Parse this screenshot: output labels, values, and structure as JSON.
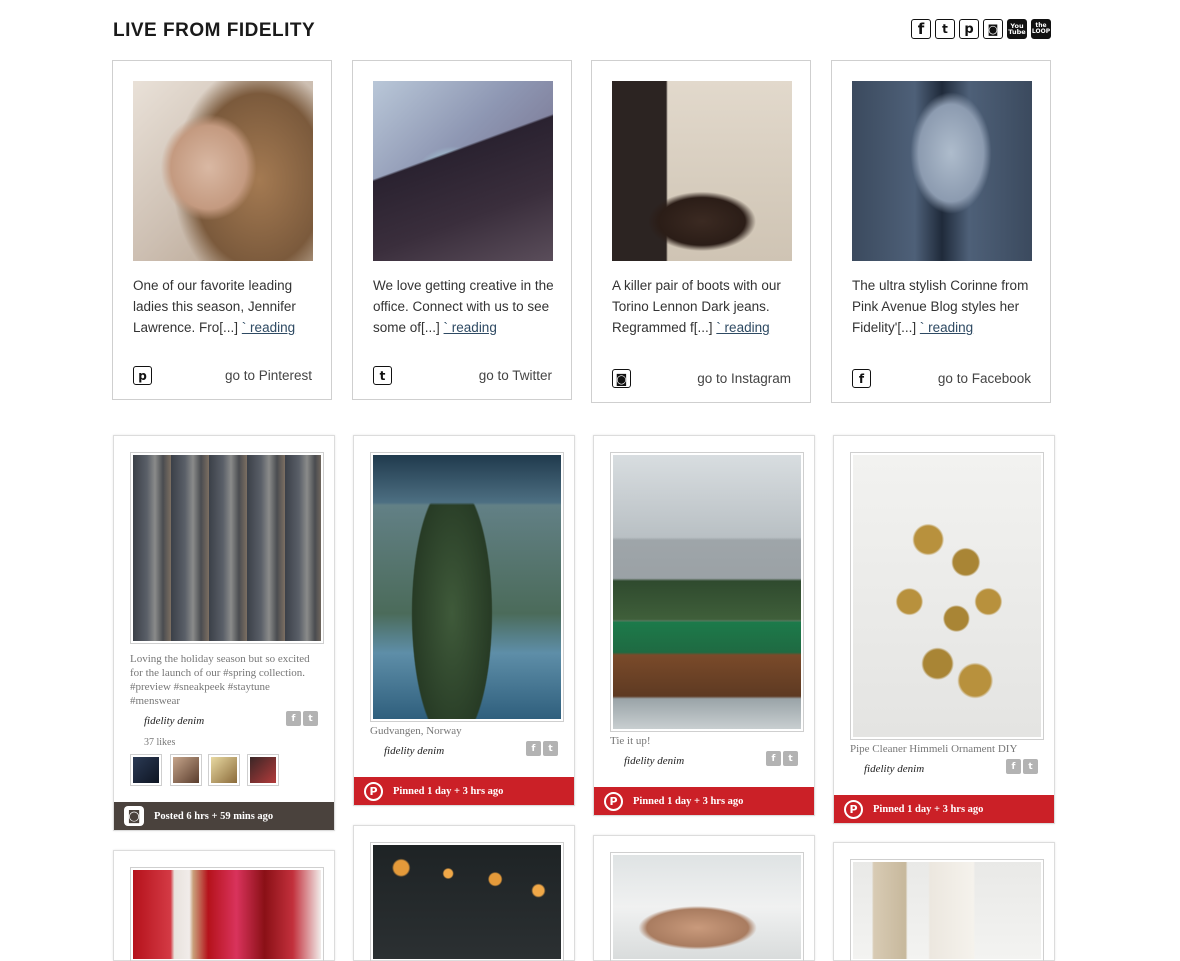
{
  "header": {
    "title": "LIVE FROM FIDELITY"
  },
  "social": [
    {
      "name": "facebook",
      "glyph": "f"
    },
    {
      "name": "twitter",
      "glyph": "t"
    },
    {
      "name": "pinterest",
      "glyph": "p"
    },
    {
      "name": "instagram",
      "glyph": "◙"
    },
    {
      "name": "youtube",
      "glyph_line1": "You",
      "glyph_line2": "Tube"
    },
    {
      "name": "the-loop",
      "glyph_line1": "the",
      "glyph_line2": "LOOP"
    }
  ],
  "top_cards": [
    {
      "text": "One of our favorite leading ladies this season, Jennifer Lawrence. Fro[...]",
      "read_more": "` reading",
      "network_icon": "pinterest-icon",
      "glyph": "p",
      "link": "go to Pinterest"
    },
    {
      "text": "We love getting creative in the office. Connect with us to see some of[...]",
      "read_more": "` reading",
      "network_icon": "twitter-icon",
      "glyph": "t",
      "link": "go to Twitter"
    },
    {
      "text": "A killer pair of boots with our Torino Lennon Dark jeans. Regrammed f[...]",
      "read_more": "` reading",
      "network_icon": "instagram-icon",
      "glyph": "◙",
      "link": "go to Instagram"
    },
    {
      "text": "The ultra stylish Corinne from Pink Avenue Blog styles her Fidelity'[...]",
      "read_more": "` reading",
      "network_icon": "facebook-icon",
      "glyph": "f",
      "link": "go to Facebook"
    }
  ],
  "pins": [
    {
      "caption": "Loving the holiday season but so excited for the launch of our #spring collection. #preview #sneakpeek #staytune #menswear",
      "author": "fidelity denim",
      "likes": "37 likes",
      "status": "Posted 6 hrs + 59 mins ago",
      "source": "instagram"
    },
    {
      "caption": "Gudvangen, Norway",
      "author": "fidelity denim",
      "status": "Pinned 1 day + 3 hrs ago",
      "source": "pinterest"
    },
    {
      "caption": "Tie it up!",
      "author": "fidelity denim",
      "status": "Pinned 1 day + 3 hrs ago",
      "source": "pinterest"
    },
    {
      "caption": "Pipe Cleaner Himmeli Ornament DIY",
      "author": "fidelity denim",
      "status": "Pinned 1 day + 3 hrs ago",
      "source": "pinterest"
    }
  ],
  "share_icons": {
    "facebook": "f",
    "twitter": "t"
  },
  "bar_icons": {
    "pinterest": "P",
    "instagram": "◙"
  },
  "colors": {
    "pinterest_red": "#cb2027",
    "instagram_bar": "#4a423d",
    "link": "#2e4a63"
  }
}
